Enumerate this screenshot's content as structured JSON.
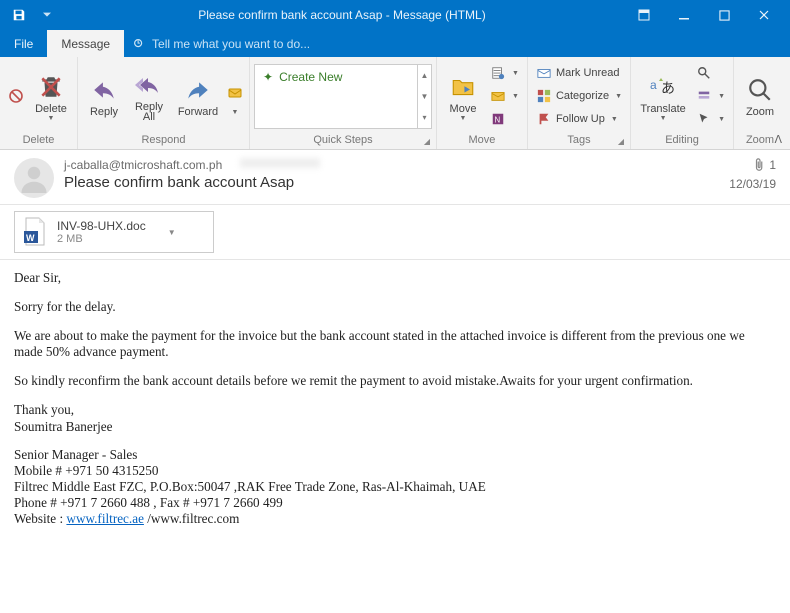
{
  "window": {
    "title": "Please confirm bank account Asap - Message (HTML)"
  },
  "tabs": {
    "file": "File",
    "message": "Message",
    "tellme": "Tell me what you want to do..."
  },
  "ribbon": {
    "delete": {
      "btn": "Delete",
      "group": "Delete"
    },
    "respond": {
      "reply": "Reply",
      "reply_all_l1": "Reply",
      "reply_all_l2": "All",
      "forward": "Forward",
      "group": "Respond"
    },
    "quicksteps": {
      "create_new": "Create New",
      "group": "Quick Steps"
    },
    "move": {
      "btn": "Move",
      "group": "Move"
    },
    "tags": {
      "unread": "Mark Unread",
      "categorize": "Categorize",
      "followup": "Follow Up",
      "group": "Tags"
    },
    "editing": {
      "translate": "Translate",
      "group": "Editing"
    },
    "zoom": {
      "btn": "Zoom",
      "group": "Zoom"
    }
  },
  "email": {
    "from": "j-caballa@tmicroshaft.com.ph",
    "to_blurred": "",
    "date": "12/03/19",
    "attach_count": "1",
    "subject": "Please confirm bank account Asap",
    "attachment": {
      "name": "INV-98-UHX.doc",
      "size": "2 MB"
    },
    "body": {
      "p1": "Dear Sir,",
      "p2": "Sorry for the delay.",
      "p3": "We are about to make the payment for the invoice but the bank account stated in the attached invoice is different from the previous one we made 50% advance payment.",
      "p4": "So kindly reconfirm the bank account details before we remit the payment to avoid mistake.Awaits for your urgent confirmation.",
      "p5a": "Thank you,",
      "p5b": "Soumitra Banerjee",
      "p6a": "Senior Manager - Sales",
      "p6b": "Mobile # +971 50 4315250",
      "p6c": "Filtrec Middle East FZC, P.O.Box:50047 ,RAK Free Trade Zone, Ras-Al-Khaimah, UAE",
      "p6d": "Phone # +971 7 2660 488 , Fax # +971 7 2660 499",
      "p6e_pre": "Website : ",
      "p6e_link": "www.filtrec.ae",
      "p6e_post": " /www.filtrec.com"
    }
  }
}
